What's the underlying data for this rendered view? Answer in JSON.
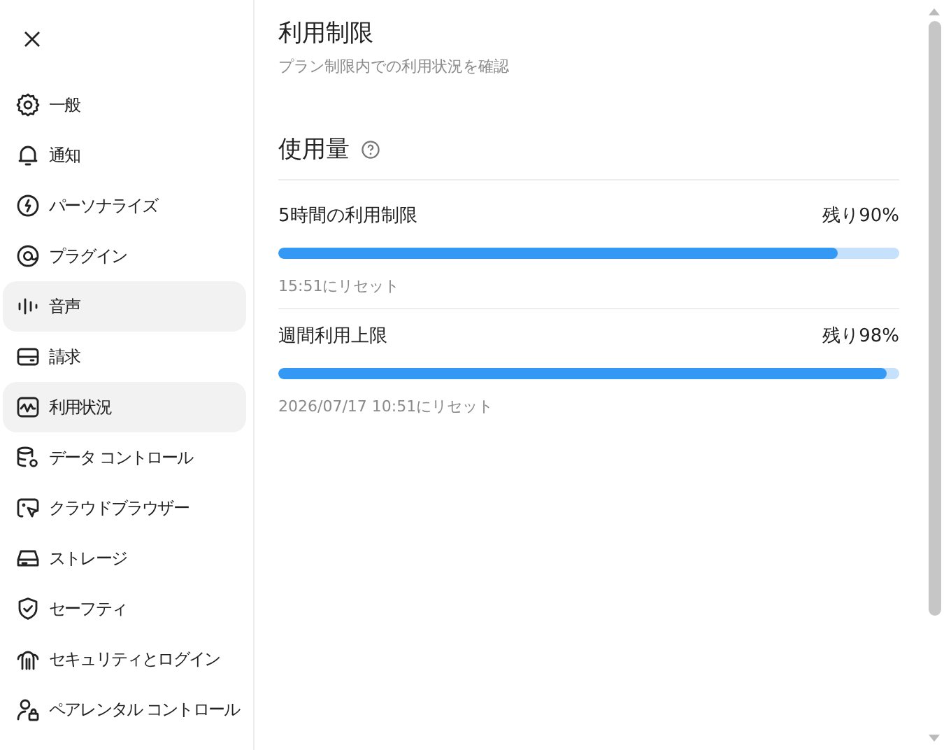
{
  "sidebar": {
    "items": [
      {
        "label": "一般",
        "selected": false,
        "hovered": false
      },
      {
        "label": "通知",
        "selected": false,
        "hovered": false
      },
      {
        "label": "パーソナライズ",
        "selected": false,
        "hovered": false
      },
      {
        "label": "プラグイン",
        "selected": false,
        "hovered": false
      },
      {
        "label": "音声",
        "selected": false,
        "hovered": true
      },
      {
        "label": "請求",
        "selected": false,
        "hovered": false
      },
      {
        "label": "利用状況",
        "selected": true,
        "hovered": false
      },
      {
        "label": "データ コントロール",
        "selected": false,
        "hovered": false
      },
      {
        "label": "クラウドブラウザー",
        "selected": false,
        "hovered": false
      },
      {
        "label": "ストレージ",
        "selected": false,
        "hovered": false
      },
      {
        "label": "セーフティ",
        "selected": false,
        "hovered": false
      },
      {
        "label": "セキュリティとログイン",
        "selected": false,
        "hovered": false
      },
      {
        "label": "ペアレンタル コントロール",
        "selected": false,
        "hovered": false
      }
    ]
  },
  "page": {
    "title": "利用制限",
    "subtitle": "プラン制限内での利用状況を確認"
  },
  "usage": {
    "heading": "使用量",
    "limits": [
      {
        "name": "5時間の利用制限",
        "remaining": "残り90%",
        "level": 0.9,
        "reset": "15:51にリセット"
      },
      {
        "name": "週間利用上限",
        "remaining": "残り98%",
        "level": 0.98,
        "reset": "2026/07/17 10:51にリセット"
      }
    ]
  }
}
